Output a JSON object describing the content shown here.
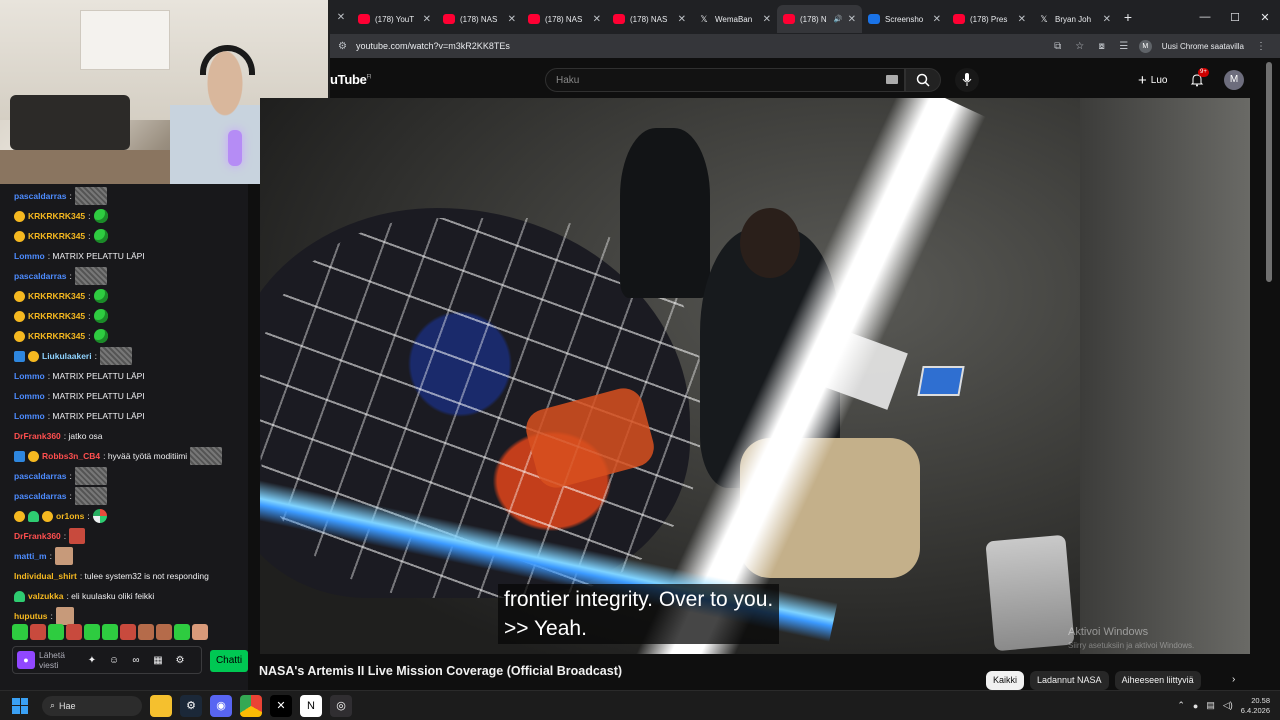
{
  "browser": {
    "tabs": [
      {
        "label": "(178) YouT",
        "favicon": "youtube-icon",
        "active": false
      },
      {
        "label": "(178) NAS",
        "favicon": "youtube-icon",
        "active": false
      },
      {
        "label": "(178) NAS",
        "favicon": "youtube-icon",
        "active": false
      },
      {
        "label": "(178) NAS",
        "favicon": "youtube-icon",
        "active": false
      },
      {
        "label": "WemaBan",
        "favicon": "x-icon",
        "active": false
      },
      {
        "label": "(178) N",
        "favicon": "youtube-icon",
        "active": true
      },
      {
        "label": "Screensho",
        "favicon": "screenshot-icon",
        "active": false
      },
      {
        "label": "(178) Pres",
        "favicon": "youtube-icon",
        "active": false
      },
      {
        "label": "Bryan Joh",
        "favicon": "x-icon",
        "active": false
      }
    ],
    "url": "youtube.com/watch?v=m3kR2KK8TEs",
    "update_label": "Uusi Chrome saatavilla",
    "profile_initial": "M"
  },
  "youtube": {
    "logo_text": "uTube",
    "logo_region": "FI",
    "search_placeholder": "Haku",
    "create_label": "Luo",
    "notif_count": "9+",
    "account_initial": "M",
    "captions": [
      "frontier integrity. Over to you.",
      ">> Yeah."
    ],
    "video_title": "NASA's Artemis II Live Mission Coverage (Official Broadcast)",
    "chips": [
      "Kaikki",
      "Ladannut NASA",
      "Aiheeseen liittyviä"
    ],
    "watermark_title": "Aktivoi Windows",
    "watermark_sub": "Siirry asetuksiin ja aktivoi Windows."
  },
  "chat": {
    "messages": [
      {
        "user": "pascaldarras",
        "color": "#4d8cff",
        "text": ":",
        "badges": [],
        "emote": "pic"
      },
      {
        "user": "KRKRKRK345",
        "color": "#f5b820",
        "text": ":",
        "badges": [
          "gold"
        ],
        "emote": "frog"
      },
      {
        "user": "KRKRKRK345",
        "color": "#f5b820",
        "text": ":",
        "badges": [
          "gold"
        ],
        "emote": "frog"
      },
      {
        "user": "Lommo",
        "color": "#4d8cff",
        "text": ": MATRIX PELATTU LÄPI",
        "badges": [],
        "emote": ""
      },
      {
        "user": "pascaldarras",
        "color": "#4d8cff",
        "text": ":",
        "badges": [],
        "emote": "pic"
      },
      {
        "user": "KRKRKRK345",
        "color": "#f5b820",
        "text": ":",
        "badges": [
          "gold"
        ],
        "emote": "frog"
      },
      {
        "user": "KRKRKRK345",
        "color": "#f5b820",
        "text": ":",
        "badges": [
          "gold"
        ],
        "emote": "frog"
      },
      {
        "user": "KRKRKRK345",
        "color": "#f5b820",
        "text": ":",
        "badges": [
          "gold"
        ],
        "emote": "frog"
      },
      {
        "user": "Liukulaakeri",
        "color": "#8fd3ff",
        "text": ":",
        "badges": [
          "blue",
          "gold"
        ],
        "emote": "pic"
      },
      {
        "user": "Lommo",
        "color": "#4d8cff",
        "text": ": MATRIX PELATTU LÄPI",
        "badges": [],
        "emote": ""
      },
      {
        "user": "Lommo",
        "color": "#4d8cff",
        "text": ": MATRIX PELATTU LÄPI",
        "badges": [],
        "emote": ""
      },
      {
        "user": "Lommo",
        "color": "#4d8cff",
        "text": ": MATRIX PELATTU LÄPI",
        "badges": [],
        "emote": ""
      },
      {
        "user": "DrFrank360",
        "color": "#ff4f4f",
        "text": ": jatko osa",
        "badges": [],
        "emote": ""
      },
      {
        "user": "Robbs3n_CB4",
        "color": "#ff4f4f",
        "text": ": hyvää työtä moditiimi",
        "badges": [
          "blue",
          "gold"
        ],
        "emote": "pic"
      },
      {
        "user": "pascaldarras",
        "color": "#4d8cff",
        "text": ":",
        "badges": [],
        "emote": "pic"
      },
      {
        "user": "pascaldarras",
        "color": "#4d8cff",
        "text": ":",
        "badges": [],
        "emote": "pic"
      },
      {
        "user": "or1ons",
        "color": "#f5b820",
        "text": ":",
        "badges": [
          "gold",
          "green",
          "gold"
        ],
        "emote": "globe"
      },
      {
        "user": "DrFrank360",
        "color": "#ff4f4f",
        "text": ":",
        "badges": [],
        "emote": "red"
      },
      {
        "user": "matti_m",
        "color": "#4d8cff",
        "text": ":",
        "badges": [],
        "emote": "face"
      },
      {
        "user": "Individual_shirt",
        "color": "#f5b820",
        "text": ": tulee system32 is not responding",
        "badges": [],
        "emote": ""
      },
      {
        "user": "valzukka",
        "color": "#f5b820",
        "text": ": eli kuulasku oliki feikki",
        "badges": [
          "green"
        ],
        "emote": ""
      },
      {
        "user": "huputus",
        "color": "#f5b820",
        "text": ":",
        "badges": [],
        "emote": "face"
      }
    ],
    "input_placeholder": "Lähetä viesti",
    "send_label": "Chatti"
  },
  "taskbar": {
    "search_label": "Hae",
    "time": "20.58",
    "date": "6.4.2026"
  },
  "colors": {
    "yt_red": "#ff0033",
    "twitch_purple": "#9147ff",
    "chat_button_green": "#00c853"
  }
}
